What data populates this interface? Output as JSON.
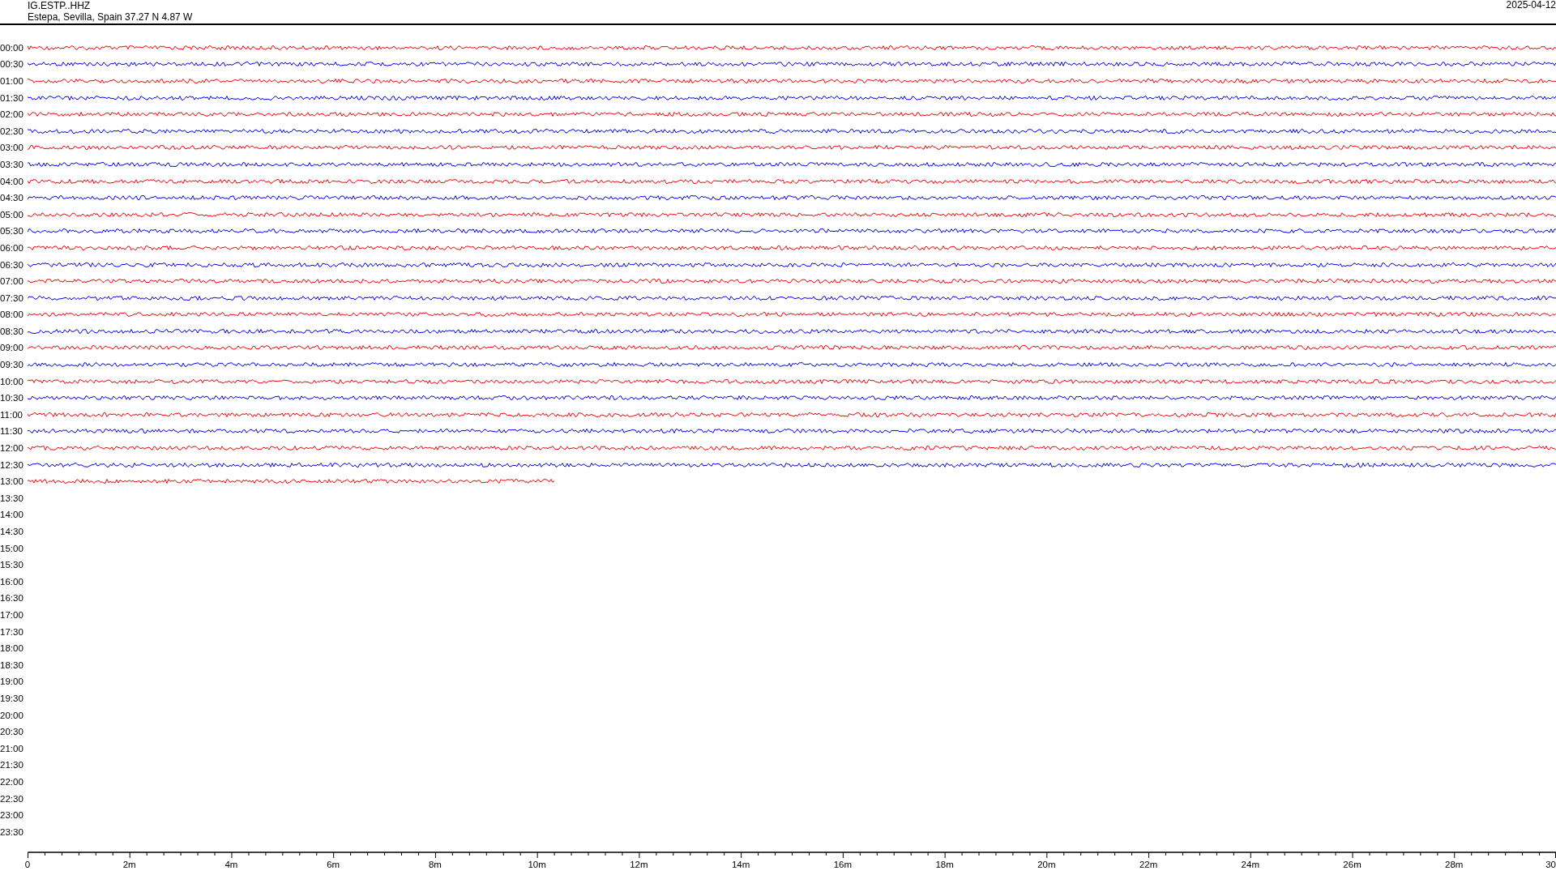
{
  "header": {
    "station": "IG.ESTP..HHZ",
    "location": "Estepa, Sevilla, Spain  37.27 N 4.87 W",
    "date": "2025-04-12"
  },
  "rows": [
    {
      "label": "00:00",
      "color": "#ff0000",
      "level": 1
    },
    {
      "label": "00:30",
      "color": "#0000ff",
      "level": 1
    },
    {
      "label": "01:00",
      "color": "#ff0000",
      "level": 1
    },
    {
      "label": "01:30",
      "color": "#0000ff",
      "level": 1
    },
    {
      "label": "02:00",
      "color": "#ff0000",
      "level": 1
    },
    {
      "label": "02:30",
      "color": "#0000ff",
      "level": 1
    },
    {
      "label": "03:00",
      "color": "#ff0000",
      "level": 1
    },
    {
      "label": "03:30",
      "color": "#0000ff",
      "level": 1
    },
    {
      "label": "04:00",
      "color": "#ff0000",
      "level": 1
    },
    {
      "label": "04:30",
      "color": "#0000ff",
      "level": 1
    },
    {
      "label": "05:00",
      "color": "#ff0000",
      "level": 1
    },
    {
      "label": "05:30",
      "color": "#0000ff",
      "level": 1
    },
    {
      "label": "06:00",
      "color": "#ff0000",
      "level": 1
    },
    {
      "label": "06:30",
      "color": "#0000ff",
      "level": 1
    },
    {
      "label": "07:00",
      "color": "#ff0000",
      "level": 1
    },
    {
      "label": "07:30",
      "color": "#0000ff",
      "level": 1
    },
    {
      "label": "08:00",
      "color": "#ff0000",
      "level": 1
    },
    {
      "label": "08:30",
      "color": "#0000ff",
      "level": 1
    },
    {
      "label": "09:00",
      "color": "#ff0000",
      "level": 1
    },
    {
      "label": "09:30",
      "color": "#0000ff",
      "level": 1
    },
    {
      "label": "10:00",
      "color": "#ff0000",
      "level": 1
    },
    {
      "label": "10:30",
      "color": "#0000ff",
      "level": 1
    },
    {
      "label": "11:00",
      "color": "#ff0000",
      "level": 1
    },
    {
      "label": "11:30",
      "color": "#0000ff",
      "level": 1
    },
    {
      "label": "12:00",
      "color": "#ff0000",
      "level": 1
    },
    {
      "label": "12:30",
      "color": "#0000ff",
      "level": 1
    },
    {
      "label": "13:00",
      "color": "#ff0000",
      "level": 0.345
    },
    {
      "label": "13:30"
    },
    {
      "label": "14:00"
    },
    {
      "label": "14:30"
    },
    {
      "label": "15:00"
    },
    {
      "label": "15:30"
    },
    {
      "label": "16:00"
    },
    {
      "label": "16:30"
    },
    {
      "label": "17:00"
    },
    {
      "label": "17:30"
    },
    {
      "label": "18:00"
    },
    {
      "label": "18:30"
    },
    {
      "label": "19:00"
    },
    {
      "label": "19:30"
    },
    {
      "label": "20:00"
    },
    {
      "label": "20:30"
    },
    {
      "label": "21:00"
    },
    {
      "label": "21:30"
    },
    {
      "label": "22:00"
    },
    {
      "label": "22:30"
    },
    {
      "label": "23:00"
    },
    {
      "label": "23:30"
    }
  ],
  "axis": {
    "ticks": [
      "0",
      "2m",
      "4m",
      "6m",
      "8m",
      "10m",
      "12m",
      "14m",
      "16m",
      "18m",
      "20m",
      "22m",
      "24m",
      "26m",
      "28m",
      "30"
    ]
  }
}
